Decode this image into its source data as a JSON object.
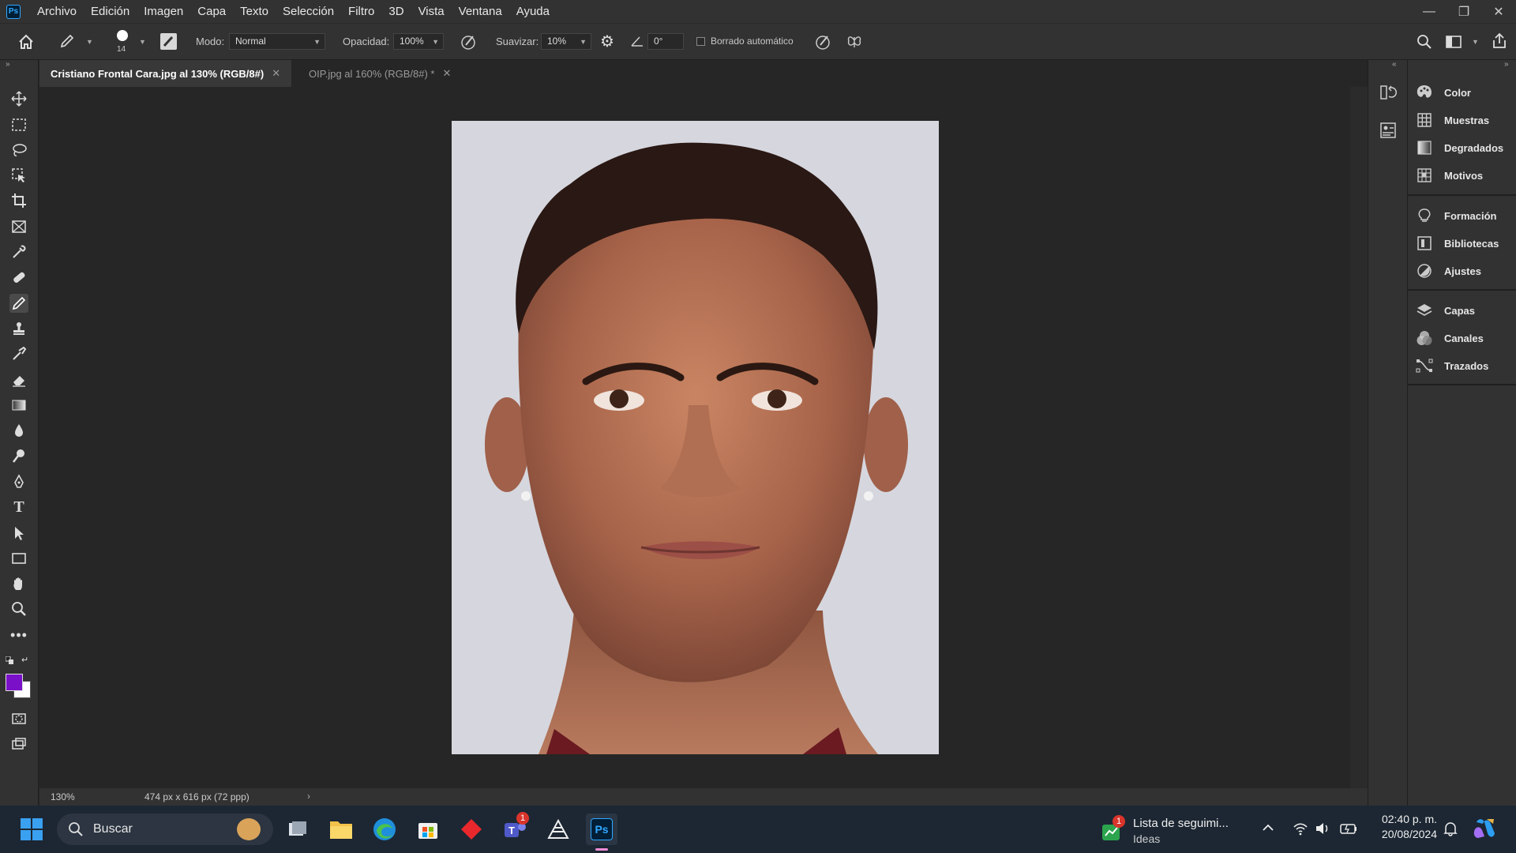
{
  "menubar": {
    "logo": "Ps",
    "items": [
      "Archivo",
      "Edición",
      "Imagen",
      "Capa",
      "Texto",
      "Selección",
      "Filtro",
      "3D",
      "Vista",
      "Ventana",
      "Ayuda"
    ]
  },
  "options": {
    "brush_size": "14",
    "mode_label": "Modo:",
    "mode_value": "Normal",
    "opacity_label": "Opacidad:",
    "opacity_value": "100%",
    "smoothing_label": "Suavizar:",
    "smoothing_value": "10%",
    "angle_value": "0°",
    "auto_erase_label": "Borrado automático"
  },
  "tabs": [
    {
      "label": "Cristiano Frontal Cara.jpg al 130% (RGB/8#)",
      "active": true
    },
    {
      "label": "OIP.jpg al 160% (RGB/8#) *",
      "active": false
    }
  ],
  "colors": {
    "foreground": "#7a10c8",
    "background": "#ffffff",
    "accent": "#31a8ff"
  },
  "status": {
    "zoom": "130%",
    "doc_info": "474 px x 616 px (72 ppp)"
  },
  "panels": {
    "group1": [
      "Color",
      "Muestras",
      "Degradados",
      "Motivos"
    ],
    "group2": [
      "Formación",
      "Bibliotecas",
      "Ajustes"
    ],
    "group3": [
      "Capas",
      "Canales",
      "Trazados"
    ]
  },
  "taskbar": {
    "search_placeholder": "Buscar",
    "teams_badge": "1",
    "widget_title": "Lista de seguimi...",
    "widget_subtitle": "Ideas",
    "widget_badge": "1",
    "time": "02:40 p. m.",
    "date": "20/08/2024"
  }
}
